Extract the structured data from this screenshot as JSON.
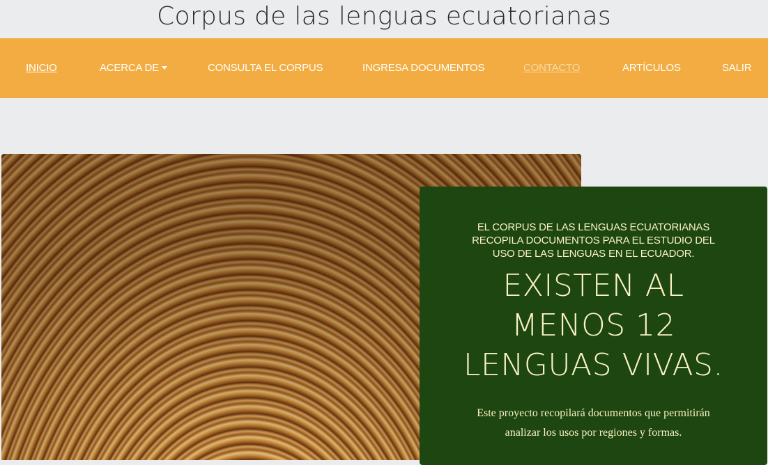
{
  "header": {
    "title": "Corpus de las lenguas ecuatorianas"
  },
  "nav": {
    "items": [
      {
        "label": "INICIO",
        "state": "active"
      },
      {
        "label": "ACERCA DE",
        "has_dropdown": true
      },
      {
        "label": "CONSULTA EL CORPUS"
      },
      {
        "label": "INGRESA DOCUMENTOS"
      },
      {
        "label": "CONTACTO",
        "state": "visited"
      },
      {
        "label": "ARTÍCULOS"
      },
      {
        "label": "SALIR"
      }
    ],
    "background_color": "#f2ac41"
  },
  "hero": {
    "image_subject": "spiral-book-tunnel"
  },
  "card": {
    "background_color": "#1d4610",
    "intro_lines": [
      "EL CORPUS DE LAS LENGUAS ECUATORIANAS",
      "RECOPILA DOCUMENTOS PARA EL ESTUDIO DEL",
      "USO DE LAS LENGUAS EN EL ECUADOR."
    ],
    "headline_lines": [
      "EXISTEN AL",
      "MENOS 12",
      "LENGUAS VIVAS."
    ],
    "body_lines": [
      "Este proyecto recopilará documentos que permitirán",
      "analizar los usos por regiones y formas."
    ]
  }
}
